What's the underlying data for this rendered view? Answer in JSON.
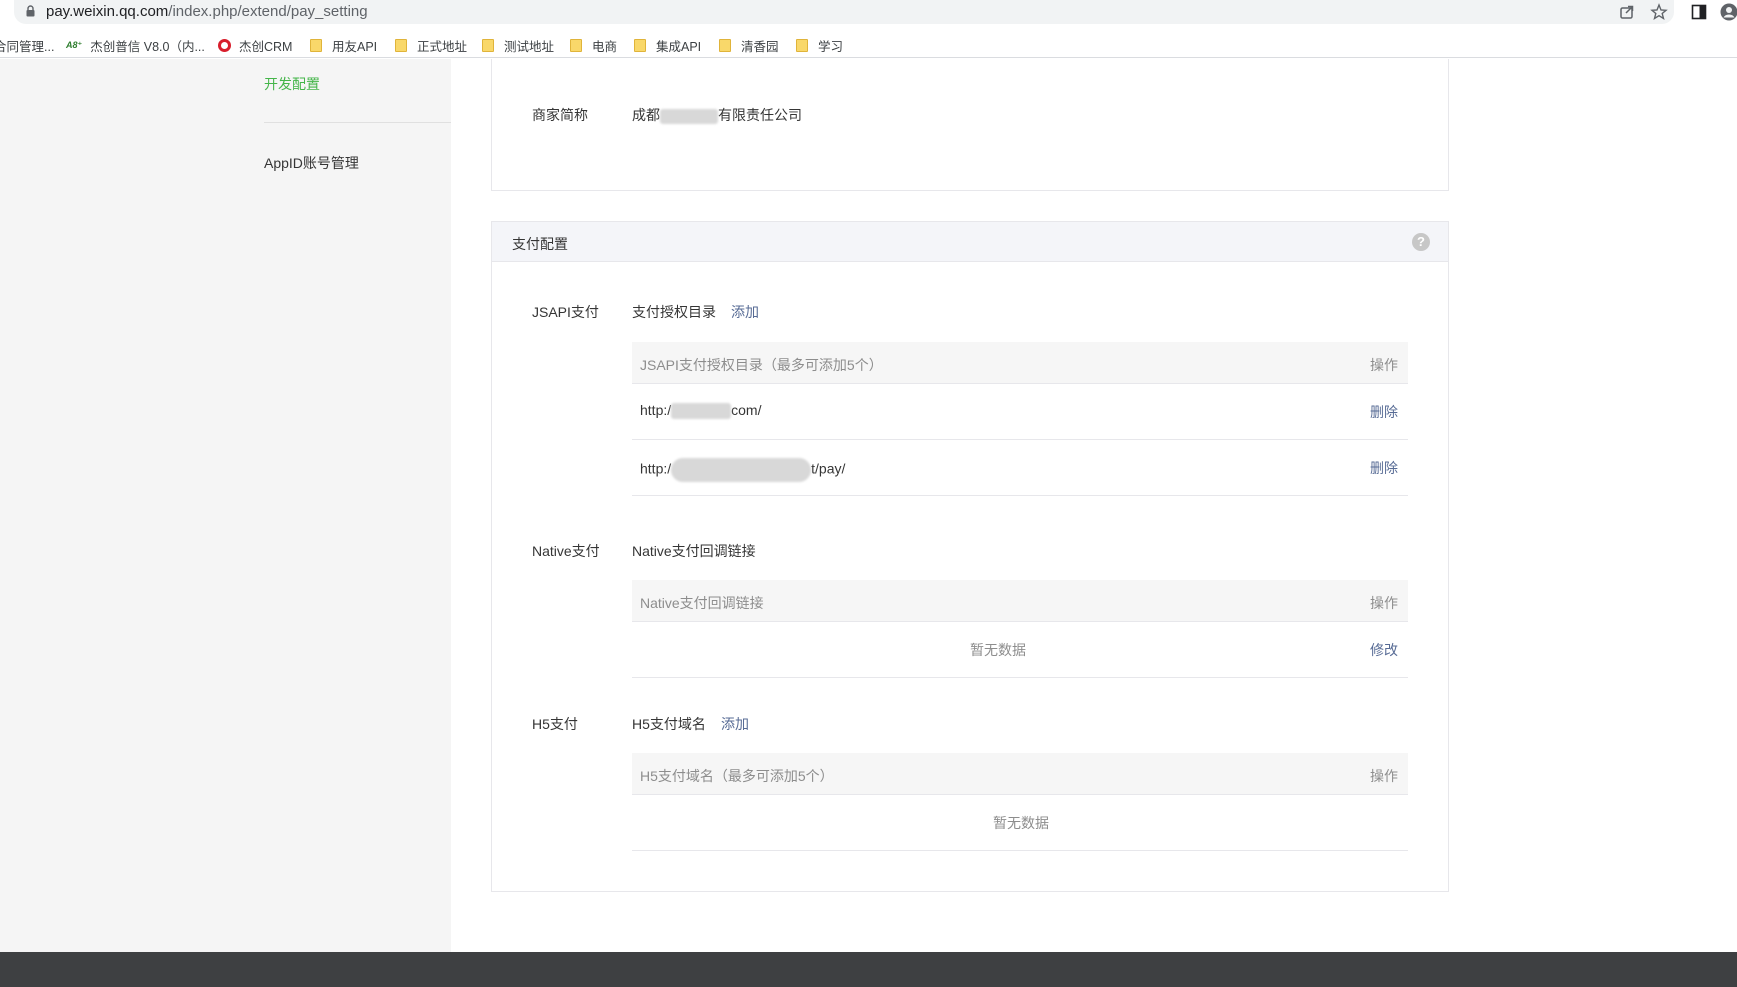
{
  "browser": {
    "url_host": "pay.weixin.qq.com",
    "url_path": "/index.php/extend/pay_setting",
    "bookmarks": [
      {
        "label": "合同管理...",
        "icon": "page-icon"
      },
      {
        "label": "杰创普信 V8.0（内...",
        "icon": "a8-icon"
      },
      {
        "label": "杰创CRM",
        "icon": "crm-icon"
      },
      {
        "label": "用友API",
        "icon": "folder-icon"
      },
      {
        "label": "正式地址",
        "icon": "folder-icon"
      },
      {
        "label": "测试地址",
        "icon": "folder-icon"
      },
      {
        "label": "电商",
        "icon": "folder-icon"
      },
      {
        "label": "集成API",
        "icon": "folder-icon"
      },
      {
        "label": "清香园",
        "icon": "folder-icon"
      },
      {
        "label": "学习",
        "icon": "folder-icon"
      }
    ]
  },
  "sidebar": {
    "active_item": "开发配置",
    "items": [
      {
        "label": "AppID账号管理"
      }
    ]
  },
  "merchant": {
    "label": "商家简称",
    "value_prefix": "成都",
    "value_suffix": "有限责任公司"
  },
  "pay_config": {
    "title": "支付配置",
    "help_icon": "?",
    "jsapi": {
      "label": "JSAPI支付",
      "sub_label": "支付授权目录",
      "add_link": "添加",
      "table_header": "JSAPI支付授权目录（最多可添加5个）",
      "action_header": "操作",
      "rows": [
        {
          "prefix": "http:/",
          "suffix": "com/",
          "action": "删除"
        },
        {
          "prefix": "http:/",
          "suffix": "t/pay/",
          "action": "删除"
        }
      ]
    },
    "native": {
      "label": "Native支付",
      "sub_label": "Native支付回调链接",
      "table_header": "Native支付回调链接",
      "action_header": "操作",
      "empty_text": "暂无数据",
      "action": "修改"
    },
    "h5": {
      "label": "H5支付",
      "sub_label": "H5支付域名",
      "add_link": "添加",
      "table_header": "H5支付域名（最多可添加5个）",
      "action_header": "操作",
      "empty_text": "暂无数据"
    }
  },
  "colors": {
    "accent_green": "#44b549",
    "link_blue": "#576b95",
    "sidebar_bg": "#f5f5f5",
    "footer_bg": "#3e4042"
  }
}
